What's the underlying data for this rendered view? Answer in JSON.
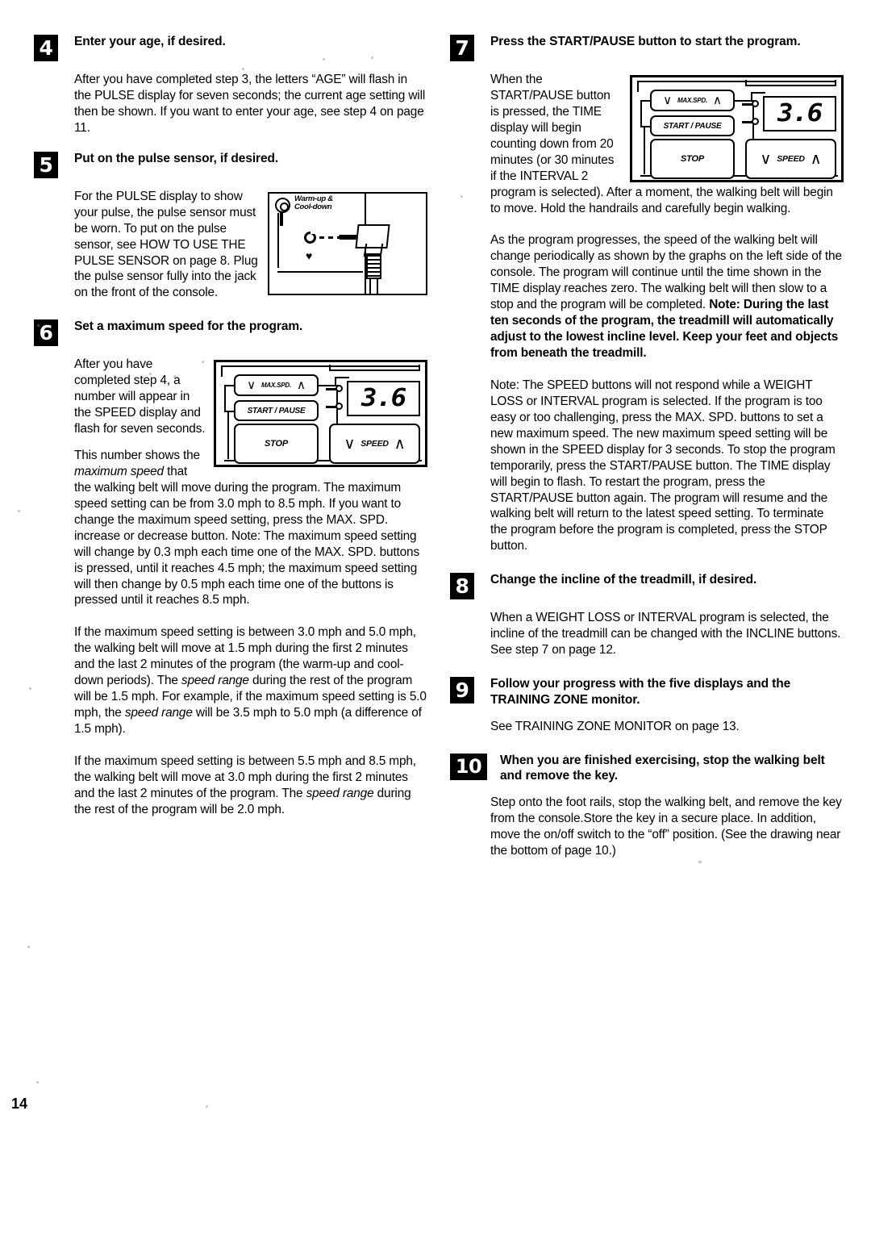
{
  "page": {
    "number": "14"
  },
  "left_column": {
    "step4": {
      "badge": "4",
      "title": "Enter your age, if desired.",
      "paragraph": "After you have completed step 3, the letters “AGE” will flash in the PULSE display for seven seconds; the current age setting will then be shown. If you want to enter your age, see step 4 on page 11."
    },
    "step5": {
      "badge": "5",
      "title": "Put on the pulse sensor, if desired.",
      "paragraph_wrap": "For the PULSE display to show your pulse, the pulse sensor must be worn. To put on the pulse sensor, see HOW TO USE THE PULSE SENSOR on page 8. Plug the pulse sensor fully into the jack on the front of the console.",
      "figure": {
        "label_line1": "Warm-up &",
        "label_line2": "Cool-down",
        "heart_glyph": "♥"
      }
    },
    "step6": {
      "badge": "6",
      "title": "Set a maximum speed for the program.",
      "paragraph_wrap": "After you have completed step 4, a number will appear in the SPEED display and flash for seven seconds.",
      "paragraph2_a": "This number shows the ",
      "paragraph2_em": "maximum speed",
      "paragraph2_b": " that the walking belt will move during the program. The maximum speed setting can be from 3.0 mph to 8.5 mph. If you want to change the maximum speed setting, press the MAX. SPD. increase or decrease button. Note: The maximum speed setting will change by 0.3 mph each time one of the MAX. SPD. buttons is pressed, until it reaches 4.5 mph; the maximum speed setting will then change by 0.5 mph each time one of the buttons is pressed until it reaches 8.5 mph.",
      "paragraph3_a": "If the maximum speed setting is between 3.0 mph and 5.0 mph, the walking belt will move at 1.5 mph during the first 2 minutes and the last 2 minutes of the program (the warm-up and cool-down periods). The ",
      "paragraph3_em1": "speed range",
      "paragraph3_b": " during the rest of the program will be 1.5 mph. For example, if the maximum speed setting is 5.0 mph, the ",
      "paragraph3_em2": "speed range",
      "paragraph3_c": " will be 3.5 mph to 5.0 mph (a difference of 1.5 mph).",
      "paragraph4_a": "If the maximum speed setting is between 5.5 mph and 8.5 mph, the walking belt will move at 3.0 mph during the first 2 minutes and the last 2 minutes of the program. The ",
      "paragraph4_em": "speed range",
      "paragraph4_b": " during the rest of the program will be 2.0 mph."
    }
  },
  "right_column": {
    "step7": {
      "badge": "7",
      "title": "Press the START/PAUSE button to start the program.",
      "paragraph_wrap": "When the START/PAUSE button is pressed, the TIME display will begin counting down from 20 minutes (or 30 minutes if the INTERVAL 2 program is selected). After a moment, the walking belt will begin to move. Hold the handrails and carefully begin walking.",
      "paragraph2_normal": "As the program progresses, the speed of the walking belt will change periodically as shown by the graphs on the left side of the console. The program will continue until the time shown in the TIME display reaches zero. The walking belt will then slow to a stop and the program will be completed. ",
      "paragraph2_bold": "Note: During the last ten seconds of the program, the treadmill will automatically adjust to the lowest incline level. Keep your feet and objects from beneath the treadmill.",
      "paragraph3": "Note: The SPEED buttons will not respond while a WEIGHT LOSS or INTERVAL program is selected. If the program is too easy or too challenging, press the MAX. SPD. buttons to set a new maximum speed. The new maximum speed setting will be shown in the SPEED display for 3 seconds. To stop the program temporarily, press the START/PAUSE button. The TIME display will begin to flash. To restart the program, press the START/PAUSE button again. The program will resume and the walking belt will return to the latest speed setting. To terminate the program before the program is completed, press the STOP button."
    },
    "step8": {
      "badge": "8",
      "title": "Change the incline of the treadmill, if desired.",
      "paragraph": "When a WEIGHT LOSS or INTERVAL program is selected, the incline of the treadmill can be changed with the INCLINE buttons. See step 7 on page 12."
    },
    "step9": {
      "badge": "9",
      "title": "Follow your progress with the five displays and the TRAINING ZONE monitor.",
      "paragraph": "See TRAINING ZONE MONITOR on page 13."
    },
    "step10": {
      "badge": "10",
      "title": "When you are finished exercising, stop the walking belt and remove the key.",
      "paragraph": "Step onto the foot rails, stop the walking belt, and remove the key from the console.Store the key in a secure place. In addition, move the on/off switch to the “off” position. (See the drawing near the bottom of page 10.)"
    }
  },
  "console_figure": {
    "max_spd_label": "MAX.SPD.",
    "start_pause_label": "START / PAUSE",
    "stop_label": "STOP",
    "speed_label": "SPEED",
    "display_value": "3.6",
    "arrow_down": "∨",
    "arrow_up": "∧"
  }
}
